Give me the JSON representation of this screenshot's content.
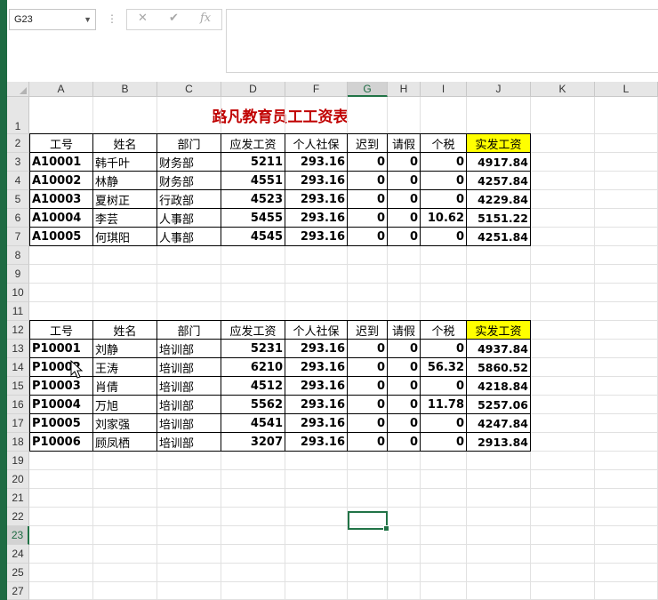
{
  "namebox": {
    "value": "G23"
  },
  "formula_bar": {
    "more_icon": "⋮",
    "cancel_icon": "✕",
    "enter_icon": "✔",
    "fx_icon": "fx",
    "content": ""
  },
  "columns": [
    "A",
    "B",
    "C",
    "D",
    "F",
    "G",
    "H",
    "I",
    "J",
    "K",
    "L"
  ],
  "rows": [
    "1",
    "2",
    "3",
    "4",
    "5",
    "6",
    "7",
    "8",
    "9",
    "10",
    "11",
    "12",
    "13",
    "14",
    "15",
    "16",
    "17",
    "18",
    "19",
    "20",
    "21",
    "22",
    "23",
    "24",
    "25",
    "26",
    "27"
  ],
  "selected": {
    "column": "G",
    "row": "23"
  },
  "sheet": {
    "title": "路凡教育员工工资表",
    "headers": [
      "工号",
      "姓名",
      "部门",
      "应发工资",
      "个人社保",
      "迟到",
      "请假",
      "个税",
      "实发工资"
    ],
    "table1": [
      [
        "A10001",
        "韩千叶",
        "财务部",
        "5211",
        "293.16",
        "0",
        "0",
        "0",
        "4917.84"
      ],
      [
        "A10002",
        "林静",
        "财务部",
        "4551",
        "293.16",
        "0",
        "0",
        "0",
        "4257.84"
      ],
      [
        "A10003",
        "夏树正",
        "行政部",
        "4523",
        "293.16",
        "0",
        "0",
        "0",
        "4229.84"
      ],
      [
        "A10004",
        "李芸",
        "人事部",
        "5455",
        "293.16",
        "0",
        "0",
        "10.62",
        "5151.22"
      ],
      [
        "A10005",
        "何琪阳",
        "人事部",
        "4545",
        "293.16",
        "0",
        "0",
        "0",
        "4251.84"
      ]
    ],
    "table2": [
      [
        "P10001",
        "刘静",
        "培训部",
        "5231",
        "293.16",
        "0",
        "0",
        "0",
        "4937.84"
      ],
      [
        "P10002",
        "王涛",
        "培训部",
        "6210",
        "293.16",
        "0",
        "0",
        "56.32",
        "5860.52"
      ],
      [
        "P10003",
        "肖倩",
        "培训部",
        "4512",
        "293.16",
        "0",
        "0",
        "0",
        "4218.84"
      ],
      [
        "P10004",
        "万旭",
        "培训部",
        "5562",
        "293.16",
        "0",
        "0",
        "11.78",
        "5257.06"
      ],
      [
        "P10005",
        "刘家强",
        "培训部",
        "4541",
        "293.16",
        "0",
        "0",
        "0",
        "4247.84"
      ],
      [
        "P10006",
        "顾凤栖",
        "培训部",
        "3207",
        "293.16",
        "0",
        "0",
        "0",
        "2913.84"
      ]
    ]
  },
  "colors": {
    "accent": "#217346",
    "title": "#c00000",
    "highlight": "#ffff00"
  }
}
